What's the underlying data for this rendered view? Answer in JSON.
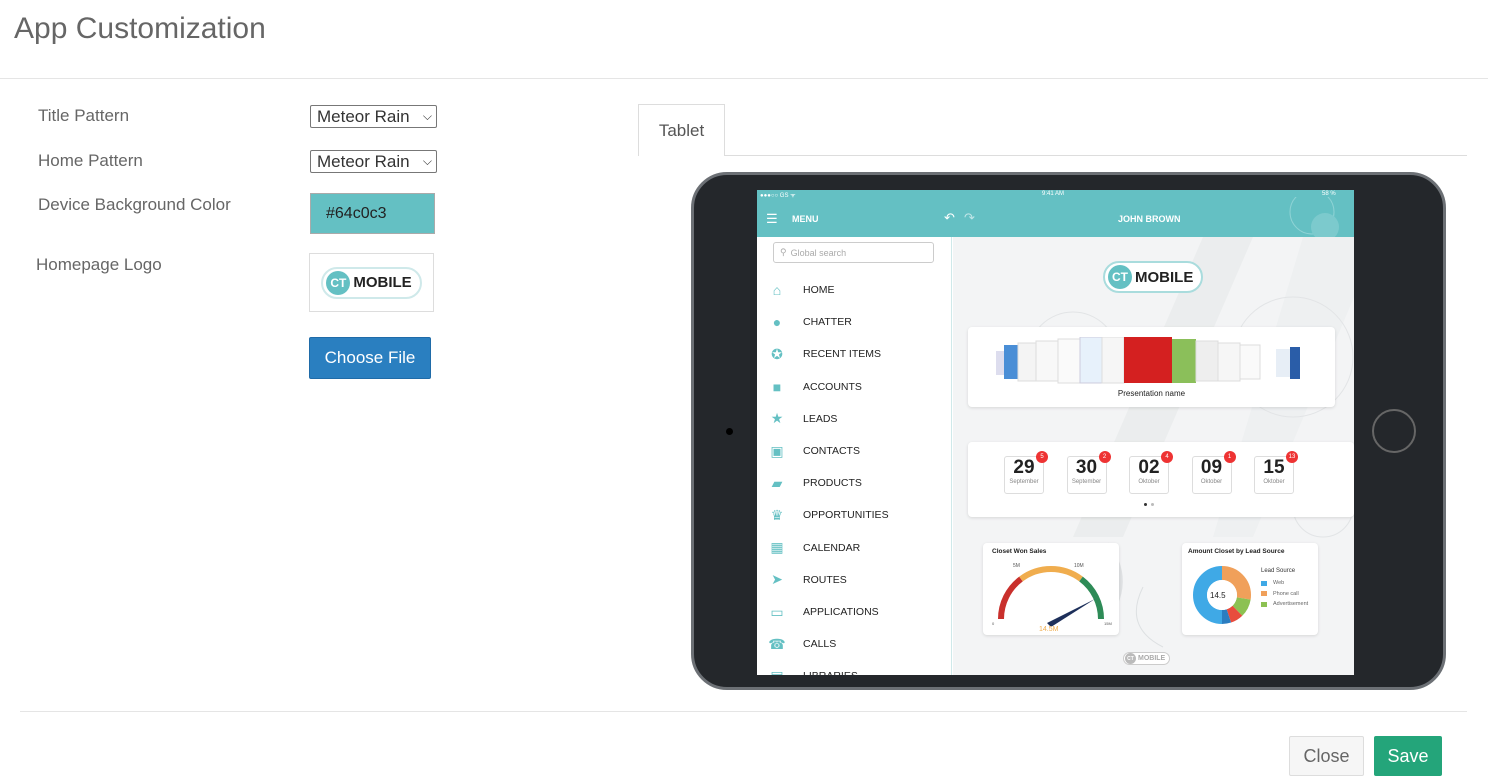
{
  "page": {
    "title": "App Customization"
  },
  "form": {
    "title_pattern": {
      "label": "Title Pattern",
      "value": "Meteor Rain"
    },
    "home_pattern": {
      "label": "Home Pattern",
      "value": "Meteor Rain"
    },
    "device_bg": {
      "label": "Device Background Color",
      "value": "#64c0c3"
    },
    "homepage_logo": {
      "label": "Homepage Logo",
      "logo_ct": "CT",
      "logo_text": "MOBILE"
    },
    "choose_file_label": "Choose File"
  },
  "preview": {
    "tab_label": "Tablet",
    "status": {
      "left": "●●●○○ GS ᯤ",
      "time": "9:41 AM",
      "battery": "58 %"
    },
    "appbar": {
      "menu_label": "MENU",
      "user": "JOHN BROWN"
    },
    "search_placeholder": "Global search",
    "menu_items": [
      {
        "label": "HOME",
        "icon": "home-icon"
      },
      {
        "label": "CHATTER",
        "icon": "chatter-icon"
      },
      {
        "label": "RECENT ITEMS",
        "icon": "star-icon"
      },
      {
        "label": "ACCOUNTS",
        "icon": "folder-icon"
      },
      {
        "label": "LEADS",
        "icon": "person-icon"
      },
      {
        "label": "CONTACTS",
        "icon": "contact-card-icon"
      },
      {
        "label": "PRODUCTS",
        "icon": "box-icon"
      },
      {
        "label": "OPPORTUNITIES",
        "icon": "crown-icon"
      },
      {
        "label": "CALENDAR",
        "icon": "calendar-icon"
      },
      {
        "label": "ROUTES",
        "icon": "navigation-icon"
      },
      {
        "label": "APPLICATIONS",
        "icon": "presentation-icon"
      },
      {
        "label": "CALLS",
        "icon": "phone-icon"
      },
      {
        "label": "LIBRARIES",
        "icon": "library-icon"
      }
    ],
    "logo_ct": "CT",
    "logo_text": "MOBILE",
    "presentation_caption": "Presentation name",
    "dates": [
      {
        "day": "29",
        "month": "September",
        "badge": "5"
      },
      {
        "day": "30",
        "month": "September",
        "badge": "2"
      },
      {
        "day": "02",
        "month": "Oktober",
        "badge": "4"
      },
      {
        "day": "09",
        "month": "Oktober",
        "badge": "1"
      },
      {
        "day": "15",
        "month": "Oktober",
        "badge": "13"
      }
    ],
    "gauge": {
      "title": "Closet Won Sales",
      "value_label": "14.5M",
      "tick_5m": "5M",
      "tick_10m": "10M",
      "tick_0": "0",
      "tick_15m": "15M"
    },
    "donut": {
      "title": "Amount Closet by Lead Source",
      "center": "14.5",
      "legend_title": "Lead Source",
      "legend": [
        {
          "label": "Web",
          "color": "#3fa9e6"
        },
        {
          "label": "Phone call",
          "color": "#f0a05a"
        },
        {
          "label": "Advertisement",
          "color": "#8cc152"
        }
      ]
    },
    "footer_logo_ct": "CT",
    "footer_logo_text": "MOBILE"
  },
  "footer": {
    "close_label": "Close",
    "save_label": "Save"
  }
}
